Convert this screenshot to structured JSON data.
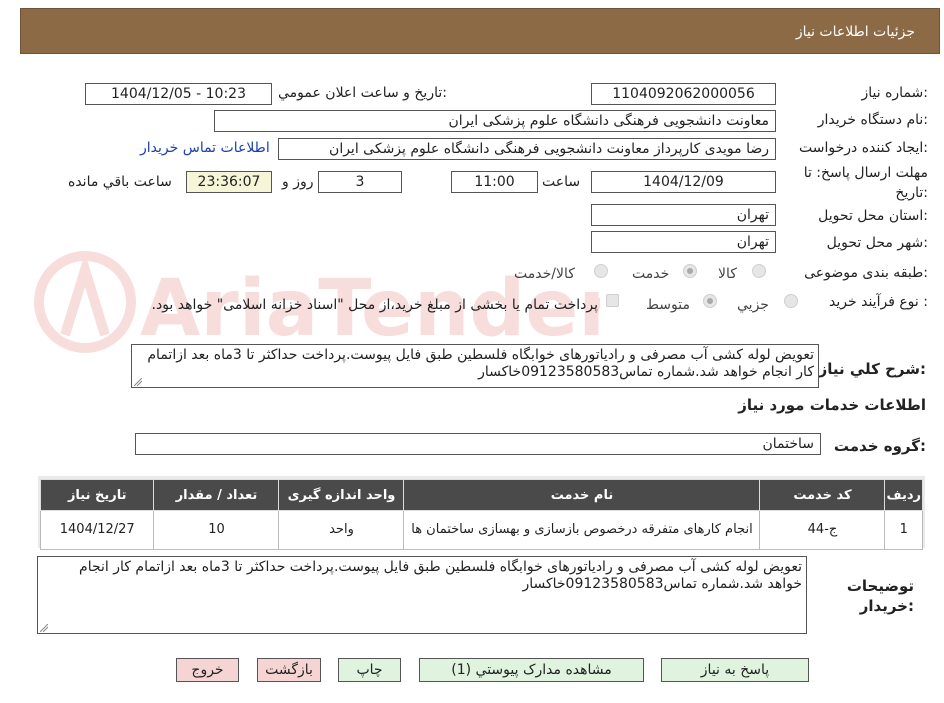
{
  "header": {
    "title": "جزئیات اطلاعات نیاز"
  },
  "watermark": "AriaTender.neT",
  "fields": {
    "need_number_label": "شماره نیاز:",
    "need_number": "1104092062000056",
    "announce_label": "تاریخ و ساعت اعلان عمومي:",
    "announce_value": "1404/12/05 - 10:23",
    "buyer_org_label": "نام دستگاه خريدار:",
    "buyer_org": "معاونت دانشجویی  فرهنگی دانشگاه علوم پزشکی ایران",
    "requester_label": "ايجاد کننده درخواست:",
    "requester": "رضا  مویدی  کارپرداز معاونت دانشجویی  فرهنگی دانشگاه علوم پزشکی ایران",
    "contact_link": "اطلاعات تماس خريدار",
    "deadline_label_line1": "مهلت ارسال پاسخ: تا",
    "deadline_label_line2": "تاریخ:",
    "deadline_date": "1404/12/09",
    "time_label": "ساعت",
    "deadline_time": "11:00",
    "days": "3",
    "days_label": "روز و",
    "remaining": "23:36:07",
    "remaining_label": "ساعت باقي مانده",
    "province_label": "استان محل تحویل:",
    "province": "تهران",
    "city_label": "شهر محل تحویل:",
    "city": "تهران",
    "category_label": "طبقه بندی موضوعی:",
    "category_options": [
      "کالا",
      "خدمت",
      "کالا/خدمت"
    ],
    "category_selected": "خدمت",
    "process_label": "نوع فرآیند خرید :",
    "process_options": [
      "جزيي",
      "متوسط"
    ],
    "process_selected": "متوسط",
    "payment_note": "پرداخت تمام یا بخشی از مبلغ خرید،از محل \"اسناد خزانه اسلامی\" خواهد بود.",
    "description_label": "شرح کلي نياز:",
    "description": "تعویض لوله کشی آب مصرفی و رادیاتورهای خوابگاه فلسطین طبق فایل پیوست.پرداخت حداکثر تا 3ماه بعد ازاتمام کار انجام خواهد شد.شماره تماس09123580583خاکسار"
  },
  "services": {
    "section_title": "اطلاعات خدمات مورد نياز",
    "group_label": "گروه خدمت:",
    "group_value": "ساختمان",
    "columns": [
      "رديف",
      "کد خدمت",
      "نام خدمت",
      "واحد اندازه گيری",
      "تعداد / مقدار",
      "تاریخ نیاز"
    ],
    "rows": [
      [
        "1",
        "ج-44",
        "انجام کارهای متفرقه درخصوص بازسازی و بهسازی ساختمان ها",
        "واحد",
        "10",
        "1404/12/27"
      ]
    ]
  },
  "buyer_notes": {
    "label_line1": "توضيحات",
    "label_line2": "خريدار:",
    "text": "تعویض لوله کشی آب مصرفی و رادیاتورهای خوابگاه فلسطین طبق فایل پیوست.پرداخت حداکثر تا 3ماه بعد ازاتمام کار انجام خواهد شد.شماره تماس09123580583خاکسار"
  },
  "buttons": {
    "reply": "پاسخ به نياز",
    "attachments": "مشاهده مدارک پيوستي (1)",
    "print": "چاپ",
    "back": "بازگشت",
    "exit": "خروج"
  },
  "colors": {
    "header": "#8b6a45",
    "button": "#dff3df",
    "button_red": "#f7d4d4",
    "table_header": "#4a4a4a",
    "link": "#1a3fb0"
  }
}
